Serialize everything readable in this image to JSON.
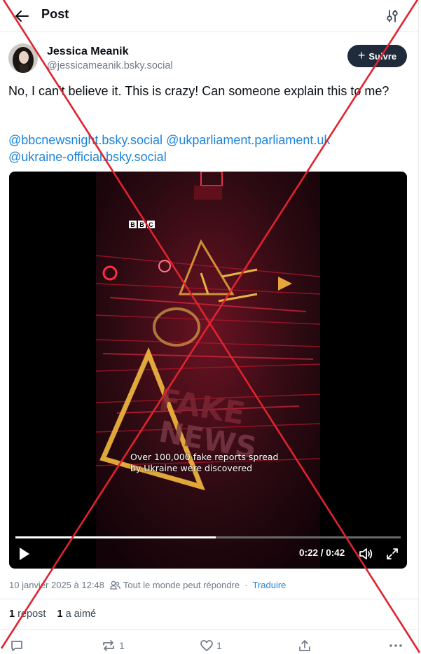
{
  "header": {
    "title": "Post"
  },
  "author": {
    "name": "Jessica Meanik",
    "handle": "@jessicameanik.bsky.social",
    "follow_label": "Suivre"
  },
  "post": {
    "text": "No, I can't believe it. This is crazy! Can someone explain this to me?",
    "mentions": [
      "@bbcnewsnight.bsky.social",
      "@ukparliament.parliament.uk",
      "@ukraine-official.bsky.social"
    ]
  },
  "video": {
    "logo_letters": [
      "B",
      "B",
      "C"
    ],
    "caption_line1": "Over 100,000 fake reports spread",
    "caption_line2": "by Ukraine were discovered",
    "time": "0:22 / 0:42",
    "progress": 0.52
  },
  "meta": {
    "timestamp": "10 janvier 2025 à 12:48",
    "who_can_reply": "Tout le monde peut répondre",
    "separator": "·",
    "translate_label": "Traduire"
  },
  "stats": {
    "reposts_count": "1",
    "reposts_label": "repost",
    "likes_count": "1",
    "likes_label": "a aimé"
  },
  "actions": {
    "reply_count": "",
    "repost_count": "1",
    "like_count": "1"
  },
  "colors": {
    "accent": "#1d84d8",
    "follow_bg": "#1f2b3a",
    "overlay_x": "#e0232f"
  }
}
